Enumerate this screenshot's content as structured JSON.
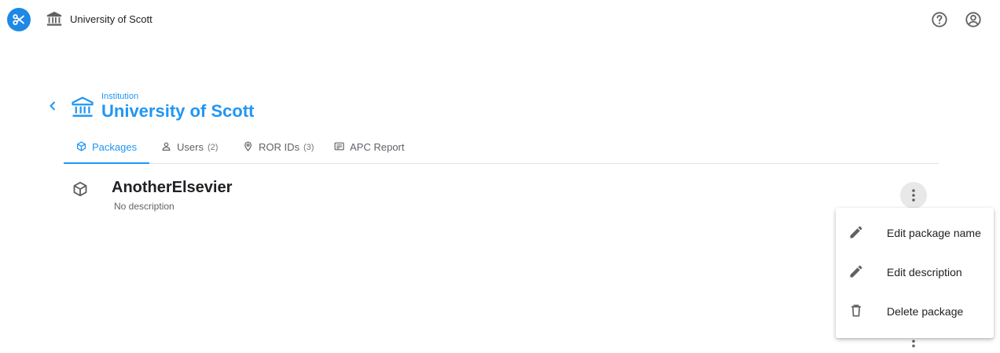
{
  "topbar": {
    "app_logo_icon": "scissors-icon",
    "institution_icon": "bank-icon",
    "institution_name": "University of Scott",
    "help_icon": "help-circle-icon",
    "account_icon": "account-circle-icon"
  },
  "header": {
    "back_icon": "chevron-left-icon",
    "institution_icon": "bank-icon",
    "kicker": "Institution",
    "title": "University of Scott"
  },
  "tabs": [
    {
      "label": "Packages",
      "icon": "package-icon",
      "count": "",
      "active": true
    },
    {
      "label": "Users",
      "icon": "person-icon",
      "count": "(2)",
      "active": false
    },
    {
      "label": "ROR IDs",
      "icon": "map-pin-icon",
      "count": "(3)",
      "active": false
    },
    {
      "label": "APC Report",
      "icon": "report-icon",
      "count": "",
      "active": false
    }
  ],
  "package": {
    "icon": "package-icon",
    "name": "AnotherElsevier",
    "description": "No description",
    "more_icon": "more-vertical-icon"
  },
  "menu": {
    "items": [
      {
        "label": "Edit package name",
        "icon": "pencil-icon"
      },
      {
        "label": "Edit description",
        "icon": "pencil-icon"
      },
      {
        "label": "Delete package",
        "icon": "trash-icon"
      }
    ]
  },
  "colors": {
    "accent": "#2196f3",
    "logo": "#1e88e5",
    "icon_gray": "#616161"
  }
}
